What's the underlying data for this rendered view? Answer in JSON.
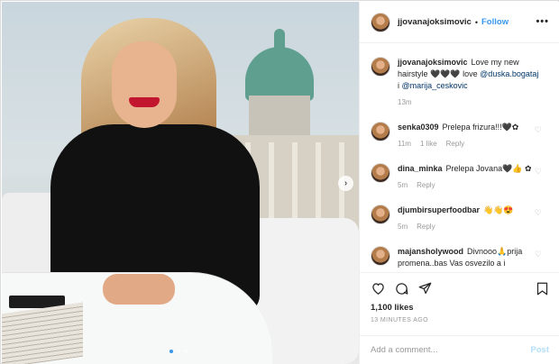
{
  "colors": {
    "accent": "#3897f0",
    "muted": "#999999",
    "text": "#262626",
    "post_disabled": "#b2dffc"
  },
  "header": {
    "username": "jjovanajoksimovic",
    "separator": "•",
    "follow_label": "Follow",
    "more_label": "•••"
  },
  "caption": {
    "username": "jjovanajoksimovic",
    "text": "Love my new hairstyle 🖤🖤🖤 love",
    "mentions": [
      "@duska.bogataj",
      "@marija_ceskovic"
    ],
    "joiner": "i",
    "time": "13m"
  },
  "comments": [
    {
      "username": "senka0309",
      "text": "Prelepa frizura!!!🖤✿",
      "time": "11m",
      "likes": "1 like",
      "reply": "Reply"
    },
    {
      "username": "dina_minka",
      "text": "Prelepa Jovana🖤👍 ✿",
      "time": "5m",
      "likes": "",
      "reply": "Reply"
    },
    {
      "username": "djumbirsuperfoodbar",
      "text": "👋👋😍",
      "time": "5m",
      "likes": "",
      "reply": "Reply"
    },
    {
      "username": "majansholywood",
      "text": "Divnooo🙏prija promena..bas Vas osvezilo a i",
      "time": "",
      "likes": "",
      "reply": ""
    }
  ],
  "actions": {
    "icons": [
      "heart-icon",
      "comment-icon",
      "share-icon",
      "bookmark-icon"
    ],
    "likes_text": "1,100 likes",
    "time_ago": "13 MINUTES AGO"
  },
  "comment_box": {
    "placeholder": "Add a comment...",
    "post_label": "Post"
  },
  "carousel": {
    "next_label": "›",
    "slide_count": 3,
    "active_index": 0
  }
}
